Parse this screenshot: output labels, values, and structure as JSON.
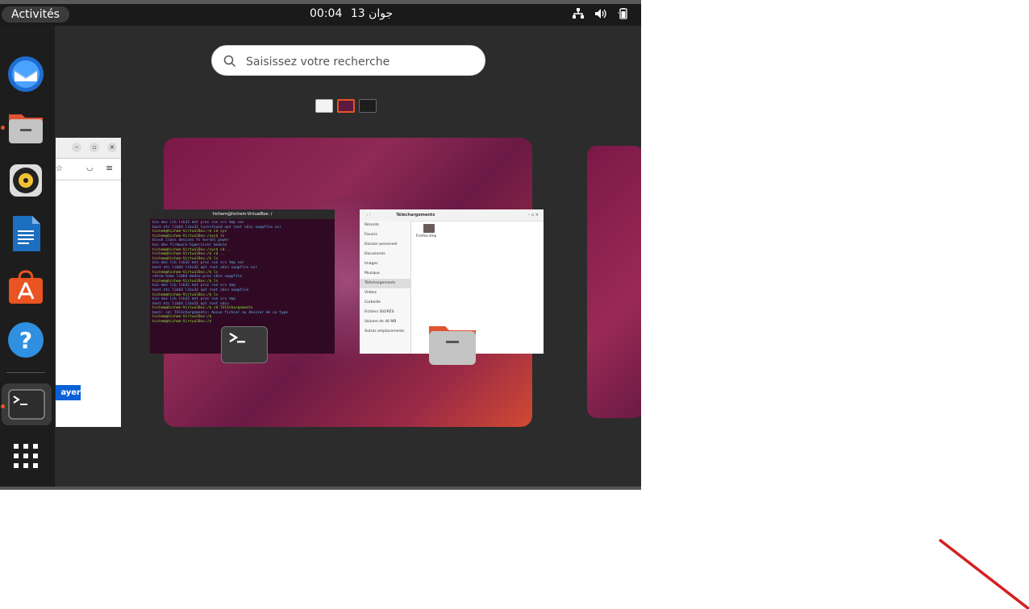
{
  "topbar": {
    "activities_label": "Activités",
    "time": "00:04",
    "date": "13 جوان",
    "tray_icons": [
      "network-icon",
      "volume-icon",
      "battery-icon"
    ]
  },
  "dock": {
    "apps": [
      {
        "name": "thunderbird-icon",
        "running": false
      },
      {
        "name": "files-icon",
        "running": true
      },
      {
        "name": "rhythmbox-icon",
        "running": false
      },
      {
        "name": "libreoffice-writer-icon",
        "running": false
      },
      {
        "name": "ubuntu-software-icon",
        "running": false
      },
      {
        "name": "help-icon",
        "running": false
      },
      {
        "name": "terminal-icon",
        "running": true
      },
      {
        "name": "show-apps-icon",
        "running": false
      }
    ]
  },
  "search": {
    "placeholder": "Saisissez votre recherche"
  },
  "left_window": {
    "button_label": "ayer"
  },
  "terminal_window": {
    "title": "hichem@hichem-VirtualBox: /",
    "lines": [
      "bin   dev   lib   lib32   mnt   proc  run   srv   tmp   var",
      "boot  etc   lib64  libx32  lost+found  opt  root  sbin  swapfile  usr",
      "hichem@hichem-VirtualBox:~$ cd sys",
      "hichem@hichem-VirtualBox:/sys$ ls",
      "block  class  devices  fs  kernel  power",
      "bus    dev    firmware  hypervisor  module",
      "hichem@hichem-VirtualBox:/sys$ cd ..",
      "hichem@hichem-VirtualBox:/$ cd ..",
      "hichem@hichem-VirtualBox:/$ ls",
      "bin   dev   lib   lib32   mnt   proc  run   srv   tmp   var",
      "boot  etc   lib64  libx32  opt   root  sbin  swapfile  usr",
      "hichem@hichem-VirtualBox:/$ ls",
      "cdrom  home  lib64  media  proc  sbin  swapfile",
      "hichem@hichem-VirtualBox:/$ ls",
      "bin   dev   lib   lib32   mnt   proc  run   srv   tmp",
      "boot  etc   lib64  libx32  opt   root  sbin  swapfile",
      "hichem@hichem-VirtualBox:/$ ls",
      "bin   dev   lib   lib32   mnt   proc  run   srv   tmp",
      "boot  etc   lib64  libx32  opt   root  sbin",
      "hichem@hichem-VirtualBox:/$ cd Téléchargements",
      "bash: cd: Téléchargements: Aucun fichier ou dossier de ce type",
      "hichem@hichem-VirtualBox:/$",
      "hichem@hichem-VirtualBox:/$"
    ]
  },
  "files_window": {
    "path": "Téléchargements",
    "sidebar": [
      "Récents",
      "Favoris",
      "Dossier personnel",
      "Documents",
      "Images",
      "Musique",
      "Téléchargements",
      "Vidéos",
      "Corbeille",
      "Fichiers ISO/RÉS",
      "Volume de 46 MB",
      "Autres emplacements"
    ],
    "selected": "Téléchargements",
    "files": [
      {
        "name": "Firefox.tmp",
        "type": "folder"
      }
    ]
  },
  "colors": {
    "accent": "#e95420",
    "wallpaper": "#8e2a55",
    "terminal_bg": "#300a24"
  }
}
